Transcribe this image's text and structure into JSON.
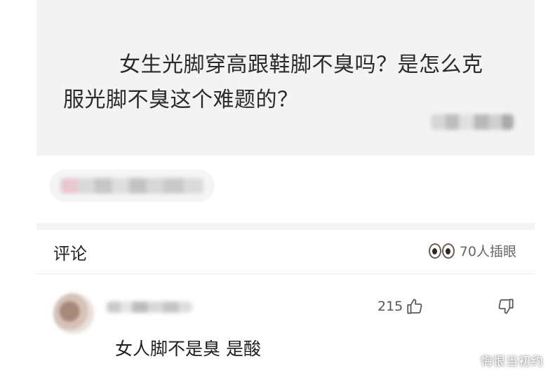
{
  "question": {
    "title": "女生光脚穿高跟鞋脚不臭吗？是怎么克服光脚不臭这个难题的？"
  },
  "comments": {
    "label": "评论",
    "watchers_text": "70人插眼"
  },
  "comment": {
    "likes": "215",
    "text": "女人脚不是臭 是酸"
  },
  "watermark": "悔恨当初约"
}
